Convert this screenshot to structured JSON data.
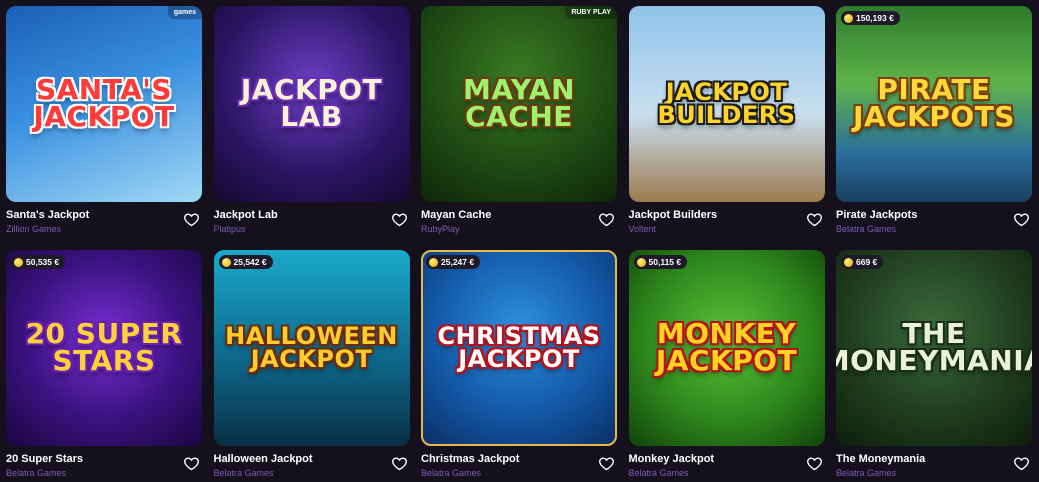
{
  "games": [
    {
      "title": "Santa's Jackpot",
      "provider": "Zillion Games",
      "art": "Santa's Jackpot",
      "jackpot": "",
      "corner": "games",
      "bg": "linear-gradient(160deg,#1b5fb8 0%,#3a8fe0 45%,#9fd8f5 100%)",
      "fg": "#ff3a3a",
      "stroke": "#ffffff"
    },
    {
      "title": "Jackpot Lab",
      "provider": "Platipus",
      "art": "Jackpot Lab",
      "jackpot": "",
      "corner": "",
      "bg": "radial-gradient(circle at 50% 40%,#6a3fc4 0%,#2b1563 60%,#120a2e 100%)",
      "fg": "#fff3d6",
      "stroke": "#6a2bb5"
    },
    {
      "title": "Mayan Cache",
      "provider": "RubyPlay",
      "art": "Mayan Cache",
      "jackpot": "",
      "corner": "RUBY PLAY",
      "bg": "radial-gradient(circle at 50% 35%,#3a7a24 0%,#1f4d14 55%,#0d2508 100%)",
      "fg": "#9df36b",
      "stroke": "#6b3b10"
    },
    {
      "title": "Jackpot Builders",
      "provider": "Voltent",
      "art": "Jackpot Builders",
      "jackpot": "",
      "corner": "",
      "bg": "linear-gradient(180deg,#8fc3ea 0%,#c9dff0 55%,#9c7a4d 100%)",
      "fg": "#ffd42a",
      "stroke": "#1c1c1c"
    },
    {
      "title": "Pirate Jackpots",
      "provider": "Belatra Games",
      "art": "Pirate Jackpots",
      "jackpot": "150,193 €",
      "corner": "",
      "bg": "linear-gradient(180deg,#2e7b2c 0%,#5fb34a 40%,#2a6f9e 75%,#1a3e5e 100%)",
      "fg": "#ffd83a",
      "stroke": "#7a3d0a"
    },
    {
      "title": "20 Super Stars",
      "provider": "Belatra Games",
      "art": "20 Super Stars",
      "jackpot": "50,535 €",
      "corner": "",
      "bg": "radial-gradient(circle at 50% 45%,#7a2fd6 0%,#3b1280 55%,#1a0640 100%)",
      "fg": "#ffd23a",
      "stroke": "#6a1fb0"
    },
    {
      "title": "Halloween Jackpot",
      "provider": "Belatra Games",
      "art": "Halloween Jackpot",
      "jackpot": "25,542 €",
      "corner": "",
      "bg": "linear-gradient(180deg,#1aa9c9 0%,#0f6f93 50%,#0a2f45 100%)",
      "fg": "#ffcc2e",
      "stroke": "#6b2a08"
    },
    {
      "title": "Christmas Jackpot",
      "provider": "Belatra Games",
      "art": "Christmas Jackpot",
      "jackpot": "25,247 €",
      "corner": "",
      "bg": "radial-gradient(circle at 50% 40%,#2f8fe0 0%,#135aa8 55%,#0a2d63 100%)",
      "fg": "#ffffff",
      "stroke": "#b5121b"
    },
    {
      "title": "Monkey Jackpot",
      "provider": "Belatra Games",
      "art": "Monkey Jackpot",
      "jackpot": "50,115 €",
      "corner": "",
      "bg": "radial-gradient(circle at 50% 45%,#5ac23a 0%,#2f8a1d 55%,#12420c 100%)",
      "fg": "#ffd21f",
      "stroke": "#b3121b"
    },
    {
      "title": "The Moneymania",
      "provider": "Belatra Games",
      "art": "The Moneymania",
      "jackpot": "669 €",
      "corner": "",
      "bg": "radial-gradient(circle at 50% 40%,#3b6b3a 0%,#213f20 55%,#0d1d0c 100%)",
      "fg": "#e9f1d6",
      "stroke": "#1a2d18"
    }
  ],
  "selected_index": 7
}
